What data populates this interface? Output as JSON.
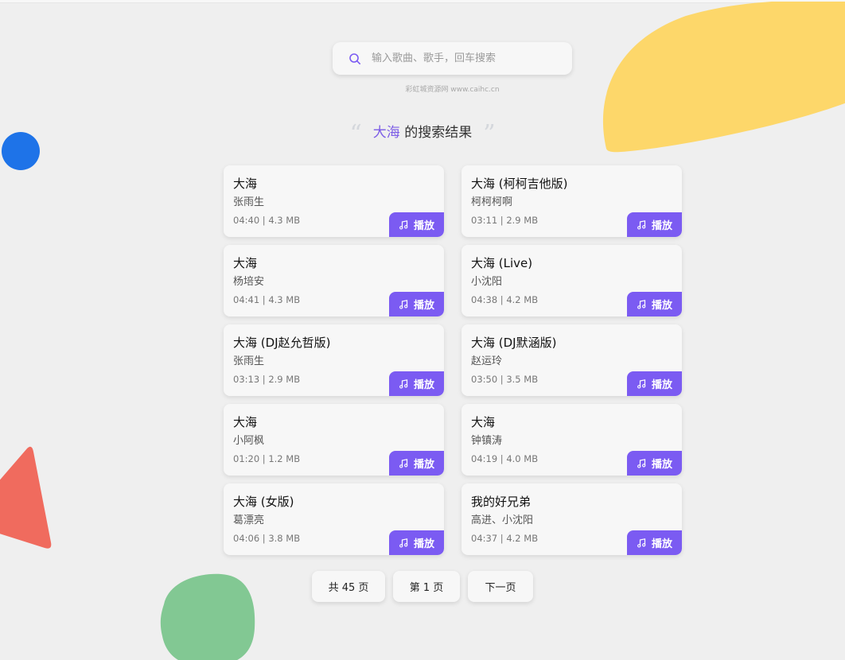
{
  "search": {
    "placeholder": "输入歌曲、歌手，回车搜索",
    "value": ""
  },
  "watermark": "彩虹城资源网 www.caihc.cn",
  "heading": {
    "quote_open": "“",
    "keyword": "大海",
    "suffix": " 的搜索结果",
    "quote_close": "”"
  },
  "results": [
    {
      "title": "大海",
      "artist": "张雨生",
      "meta": "04:40 | 4.3 MB",
      "play_label": "播放"
    },
    {
      "title": "大海 (柯柯吉他版)",
      "artist": "柯柯柯啊",
      "meta": "03:11 | 2.9 MB",
      "play_label": "播放"
    },
    {
      "title": "大海",
      "artist": "杨培安",
      "meta": "04:41 | 4.3 MB",
      "play_label": "播放"
    },
    {
      "title": "大海 (Live)",
      "artist": "小沈阳",
      "meta": "04:38 | 4.2 MB",
      "play_label": "播放"
    },
    {
      "title": "大海 (DJ赵允哲版)",
      "artist": "张雨生",
      "meta": "03:13 | 2.9 MB",
      "play_label": "播放"
    },
    {
      "title": "大海 (DJ默涵版)",
      "artist": "赵运玲",
      "meta": "03:50 | 3.5 MB",
      "play_label": "播放"
    },
    {
      "title": "大海",
      "artist": "小阿枫",
      "meta": "01:20 | 1.2 MB",
      "play_label": "播放"
    },
    {
      "title": "大海",
      "artist": "钟镇涛",
      "meta": "04:19 | 4.0 MB",
      "play_label": "播放"
    },
    {
      "title": "大海 (女版)",
      "artist": "葛漂亮",
      "meta": "04:06 | 3.8 MB",
      "play_label": "播放"
    },
    {
      "title": "我的好兄弟",
      "artist": "高进、小沈阳",
      "meta": "04:37 | 4.2 MB",
      "play_label": "播放"
    }
  ],
  "pagination": {
    "total_label": "共 45 页",
    "current_label": "第 1 页",
    "next_label": "下一页"
  },
  "colors": {
    "accent": "#7b5bf2",
    "keyword": "#7b5be6",
    "blob_yellow": "#fdd76a",
    "blob_blue": "#1e73e8",
    "blob_red": "#f06b5e",
    "blob_green": "#82c893"
  },
  "icons": {
    "search": "search-icon",
    "play": "music-note-icon"
  }
}
